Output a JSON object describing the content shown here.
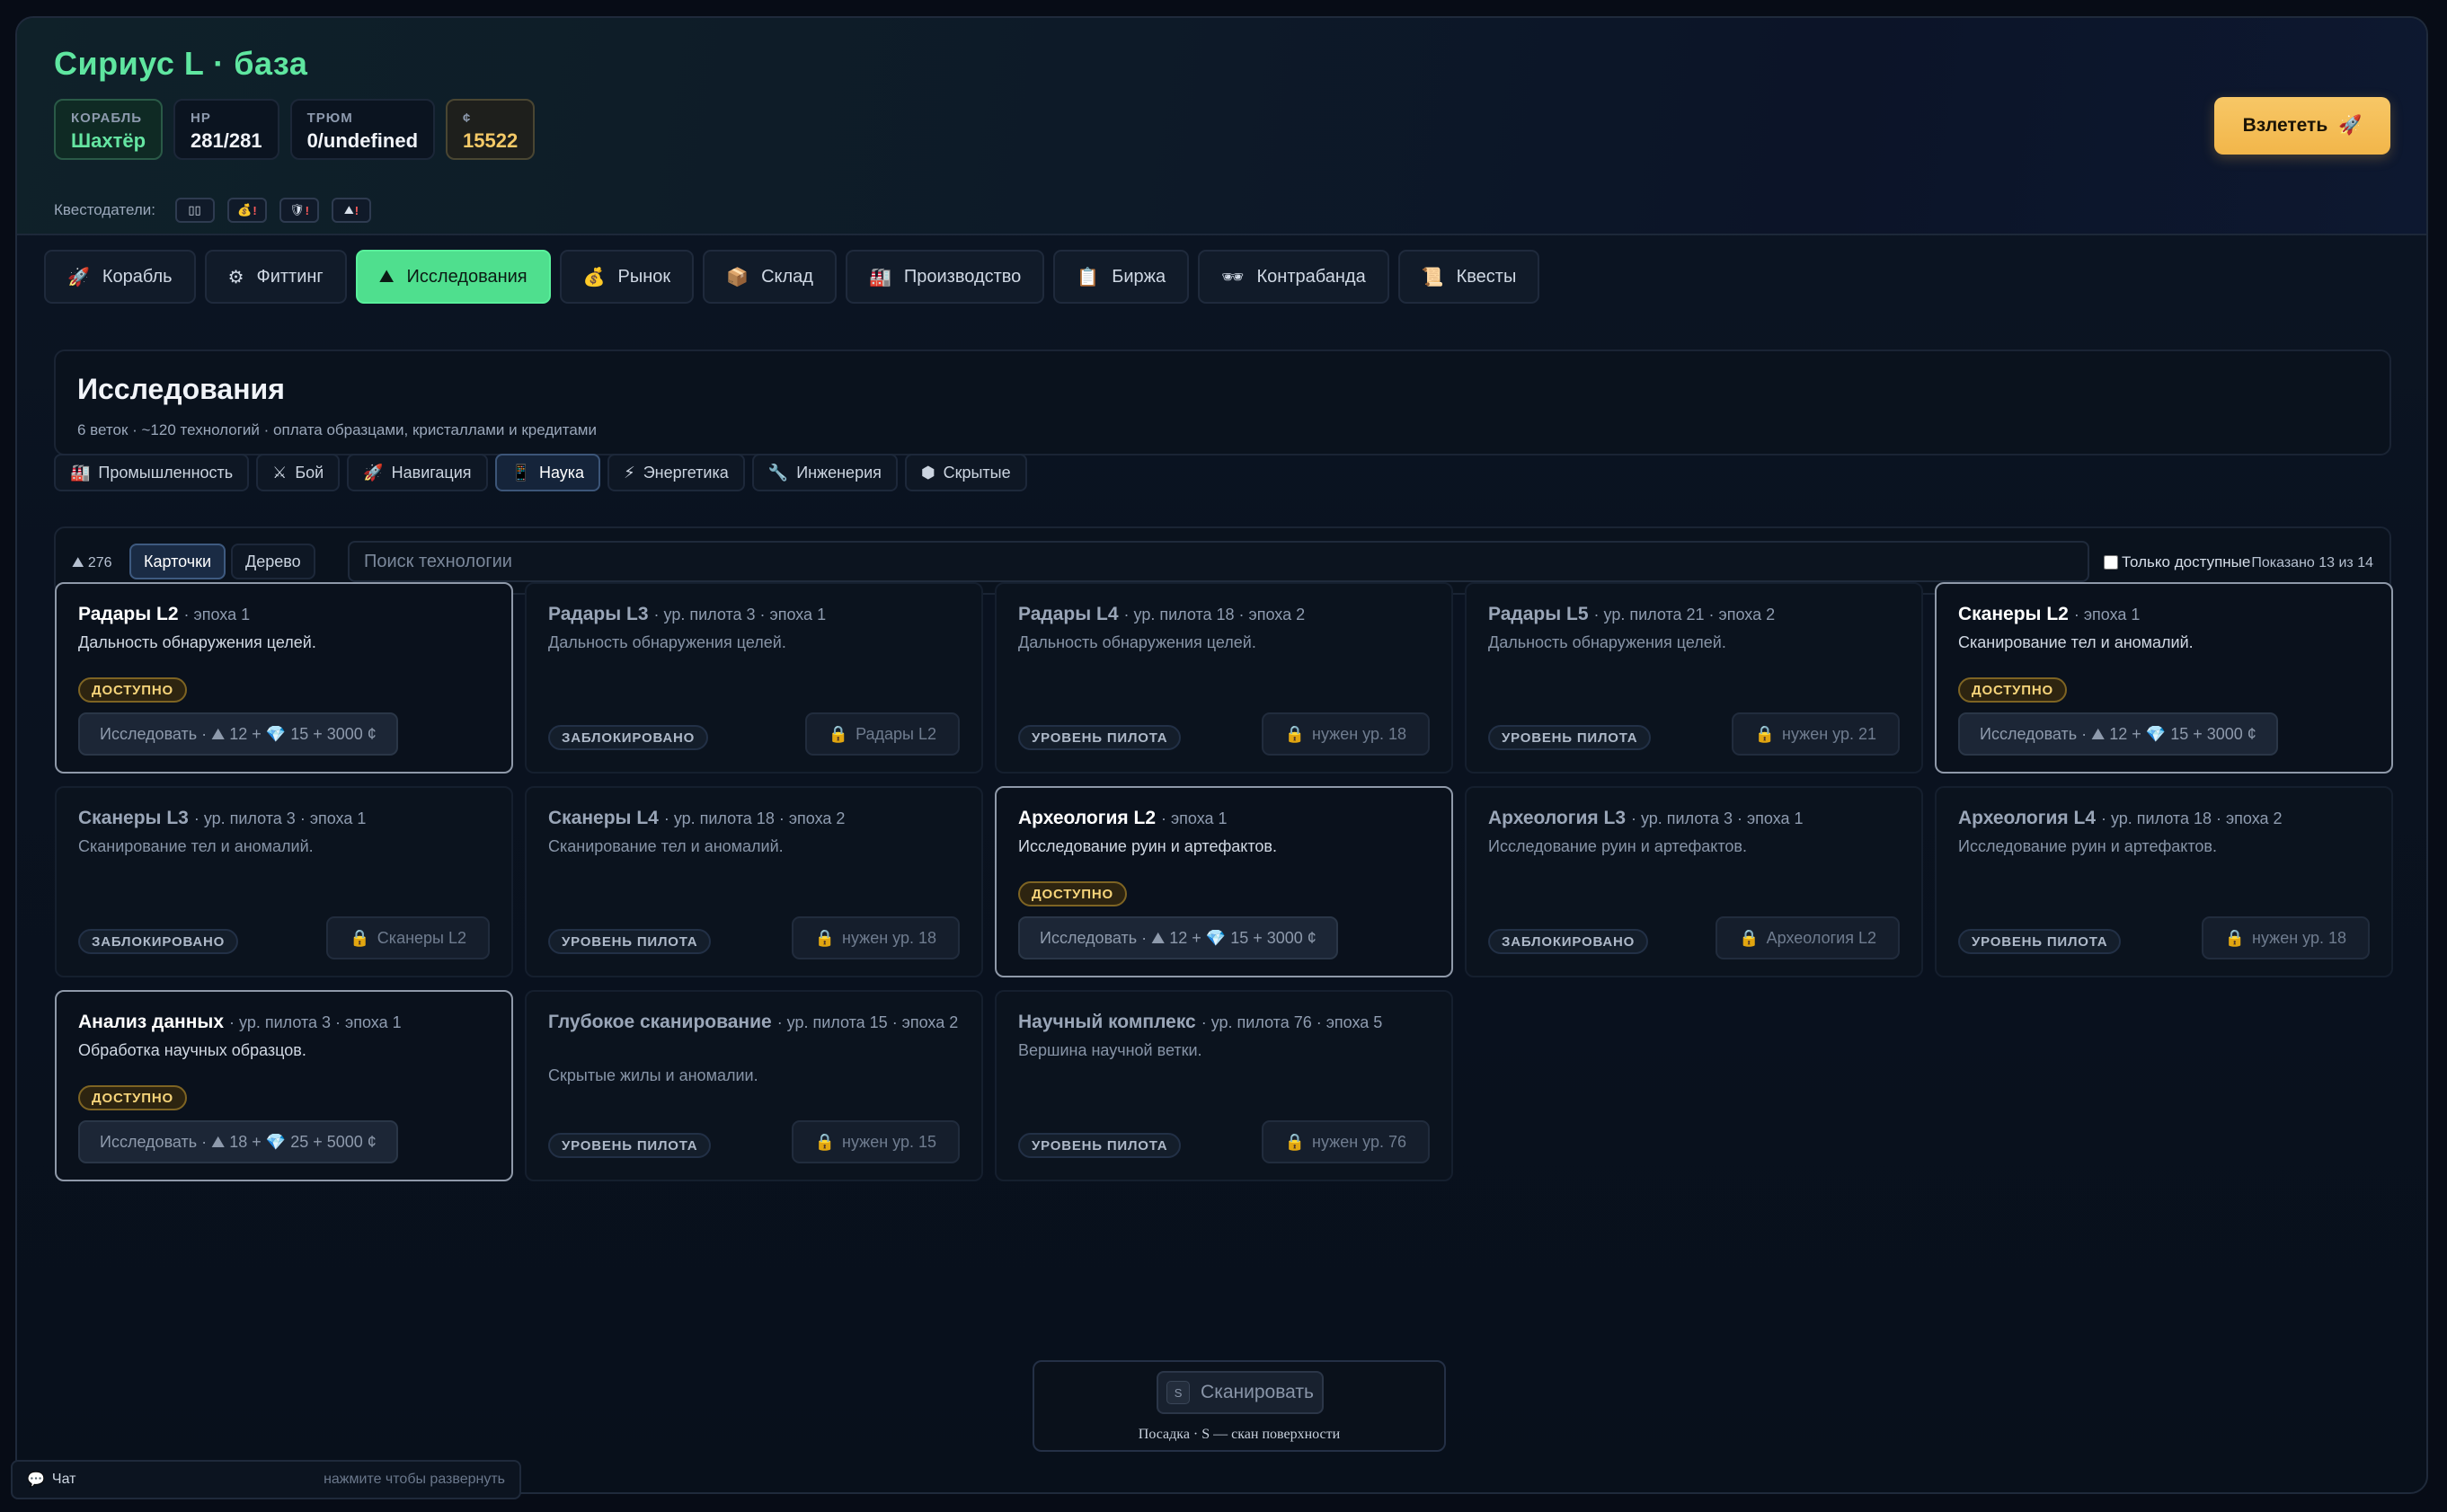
{
  "header": {
    "title": "Сириус L · база",
    "stats": [
      {
        "label": "КОРАБЛЬ",
        "value": "Шахтёр",
        "kind": "ship"
      },
      {
        "label": "HP",
        "value": "281/281",
        "kind": "plain"
      },
      {
        "label": "ТРЮМ",
        "value": "0/undefined",
        "kind": "plain"
      },
      {
        "label": "¢",
        "value": "15522",
        "kind": "credits"
      }
    ],
    "quest_label": "Квестодатели:",
    "quest_givers": [
      {
        "icon": "▯▯",
        "alert": ""
      },
      {
        "icon": "💰",
        "alert": "!"
      },
      {
        "icon": "🛡",
        "alert": "!"
      },
      {
        "icon": "⛰",
        "alert": "!"
      }
    ],
    "launch_label": "Взлететь",
    "launch_icon": "🚀"
  },
  "tabs": [
    {
      "label": "Корабль",
      "icon": "🚀"
    },
    {
      "label": "Фиттинг",
      "icon": "⚙"
    },
    {
      "label": "Исследования",
      "icon": "⛰",
      "active": true
    },
    {
      "label": "Рынок",
      "icon": "💰"
    },
    {
      "label": "Склад",
      "icon": "📦"
    },
    {
      "label": "Производство",
      "icon": "🏭"
    },
    {
      "label": "Биржа",
      "icon": "📋"
    },
    {
      "label": "Контрабанда",
      "icon": "🕶"
    },
    {
      "label": "Квесты",
      "icon": "📜"
    }
  ],
  "research": {
    "title": "Исследования",
    "subtitle": "6 веток · ~120 технологий · оплата образцами, кристаллами и кредитами"
  },
  "branches": [
    {
      "label": "Промышленность",
      "icon": "🏭"
    },
    {
      "label": "Бой",
      "icon": "⚔"
    },
    {
      "label": "Навигация",
      "icon": "🚀"
    },
    {
      "label": "Наука",
      "icon": "📱",
      "active": true
    },
    {
      "label": "Энергетика",
      "icon": "⚡"
    },
    {
      "label": "Инженерия",
      "icon": "🔧"
    },
    {
      "label": "Скрытые",
      "icon": "⬢"
    }
  ],
  "toolbar": {
    "points": "⛰ 276",
    "view_cards": "Карточки",
    "view_tree": "Дерево",
    "search_placeholder": "Поиск технологии",
    "only_available": "Только доступные",
    "shown": "Показано 13 из 14"
  },
  "cards": [
    {
      "name": "Радары L2",
      "meta": "· эпоха 1",
      "desc": "Дальность обнаружения целей.",
      "status": "ДОСТУПНО",
      "available": true,
      "action": "Исследовать · ⛰ 12 + 💎 15 + 3000 ¢"
    },
    {
      "name": "Радары L3",
      "meta": "· ур. пилота 3 · эпоха 1",
      "desc": "Дальность обнаружения целей.",
      "status": "ЗАБЛОКИРОВАНО",
      "available": false,
      "req": "Радары L2"
    },
    {
      "name": "Радары L4",
      "meta": "· ур. пилота 18 · эпоха 2",
      "desc": "Дальность обнаружения целей.",
      "status": "УРОВЕНЬ ПИЛОТА",
      "available": false,
      "req": "нужен ур. 18"
    },
    {
      "name": "Радары L5",
      "meta": "· ур. пилота 21 · эпоха 2",
      "desc": "Дальность обнаружения целей.",
      "status": "УРОВЕНЬ ПИЛОТА",
      "available": false,
      "req": "нужен ур. 21"
    },
    {
      "name": "Сканеры L2",
      "meta": "· эпоха 1",
      "desc": "Сканирование тел и аномалий.",
      "status": "ДОСТУПНО",
      "available": true,
      "action": "Исследовать · ⛰ 12 + 💎 15 + 3000 ¢"
    },
    {
      "name": "Сканеры L3",
      "meta": "· ур. пилота 3 · эпоха 1",
      "desc": "Сканирование тел и аномалий.",
      "status": "ЗАБЛОКИРОВАНО",
      "available": false,
      "req": "Сканеры L2"
    },
    {
      "name": "Сканеры L4",
      "meta": "· ур. пилота 18 · эпоха 2",
      "desc": "Сканирование тел и аномалий.",
      "status": "УРОВЕНЬ ПИЛОТА",
      "available": false,
      "req": "нужен ур. 18"
    },
    {
      "name": "Археология L2",
      "meta": "· эпоха 1",
      "desc": "Исследование руин и артефактов.",
      "status": "ДОСТУПНО",
      "available": true,
      "action": "Исследовать · ⛰ 12 + 💎 15 + 3000 ¢"
    },
    {
      "name": "Археология L3",
      "meta": "· ур. пилота 3 · эпоха 1",
      "desc": "Исследование руин и артефактов.",
      "status": "ЗАБЛОКИРОВАНО",
      "available": false,
      "req": "Археология L2"
    },
    {
      "name": "Археология L4",
      "meta": "· ур. пилота 18 · эпоха 2",
      "desc": "Исследование руин и артефактов.",
      "status": "УРОВЕНЬ ПИЛОТА",
      "available": false,
      "req": "нужен ур. 18"
    },
    {
      "name": "Анализ данных",
      "meta": "· ур. пилота 3 · эпоха 1",
      "desc": "Обработка научных образцов.",
      "status": "ДОСТУПНО",
      "available": true,
      "action": "Исследовать · ⛰ 18 + 💎 25 + 5000 ¢"
    },
    {
      "name": "Глубокое сканирование",
      "meta": "· ур. пилота 15 · эпоха 2",
      "desc": "Скрытые жилы и аномалии.",
      "status": "УРОВЕНЬ ПИЛОТА",
      "available": false,
      "req": "нужен ур. 15",
      "desc_low": true
    },
    {
      "name": "Научный комплекс",
      "meta": "· ур. пилота 76 · эпоха 5",
      "desc": "Вершина научной ветки.",
      "status": "УРОВЕНЬ ПИЛОТА",
      "available": false,
      "req": "нужен ур. 76"
    }
  ],
  "scan": {
    "key": "S",
    "label": "Сканировать",
    "hint": "Посадка · S — скан поверхности"
  },
  "chat": {
    "icon": "💬",
    "label": "Чат",
    "hint": "нажмите чтобы развернуть"
  },
  "colors": {
    "accent_green": "#4fdf8e",
    "launch_gold": "#f2b64a",
    "background": "#070c16"
  }
}
